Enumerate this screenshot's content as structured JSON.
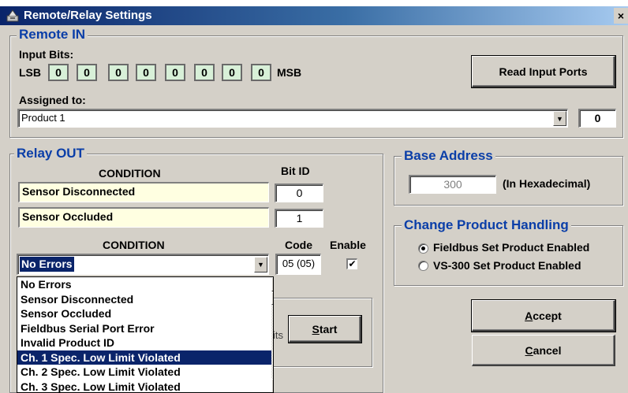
{
  "window": {
    "title": "Remote/Relay Settings",
    "close_glyph": "×",
    "icon": "app-icon"
  },
  "remote_in": {
    "title": "Remote IN",
    "input_bits_label": "Input Bits:",
    "lsb_label": "LSB",
    "msb_label": "MSB",
    "bits": [
      "0",
      "0",
      "0",
      "0",
      "0",
      "0",
      "0",
      "0"
    ],
    "read_button": "Read Input Ports",
    "assigned_label": "Assigned to:",
    "assigned_value": "Product 1",
    "assigned_number": "0"
  },
  "relay_out": {
    "title": "Relay OUT",
    "condition_header": "CONDITION",
    "bit_id_header": "Bit ID",
    "rows": [
      {
        "condition": "Sensor Disconnected",
        "bit_id": "0"
      },
      {
        "condition": "Sensor Occluded",
        "bit_id": "1"
      }
    ],
    "condition_header2": "CONDITION",
    "code_header": "Code",
    "enable_header": "Enable",
    "selected_condition": "No Errors",
    "code_value": "05 (05)",
    "enable_checked": true,
    "enable_glyph": "✔",
    "start_button": "Start",
    "start_hotkey": "S",
    "start_rest": "tart",
    "partial_text": "its"
  },
  "dropdown_list": {
    "items": [
      "No Errors",
      "Sensor Disconnected",
      "Sensor Occluded",
      "Fieldbus Serial Port Error",
      "Invalid Product ID",
      "Ch. 1 Spec. Low Limit Violated",
      "Ch. 2 Spec. Low Limit Violated",
      "Ch. 3 Spec. Low Limit Violated"
    ],
    "selected_index": 5
  },
  "base_address": {
    "title": "Base Address",
    "value": "300",
    "hint": "(In Hexadecimal)"
  },
  "product_handling": {
    "title": "Change Product Handling",
    "options": [
      {
        "label": "Fieldbus Set Product Enabled",
        "selected": true
      },
      {
        "label": "VS-300 Set Product Enabled",
        "selected": false
      }
    ]
  },
  "buttons": {
    "accept": "Accept",
    "accept_hotkey": "A",
    "accept_rest": "ccept",
    "cancel": "Cancel",
    "cancel_hotkey": "C",
    "cancel_rest": "ancel"
  },
  "colors": {
    "title_bar": "#0a246a",
    "group_title": "#0a3ea8",
    "bit_fill": "#d8f0d8",
    "condition_fill": "#ffffe1",
    "selection": "#0a246a"
  }
}
